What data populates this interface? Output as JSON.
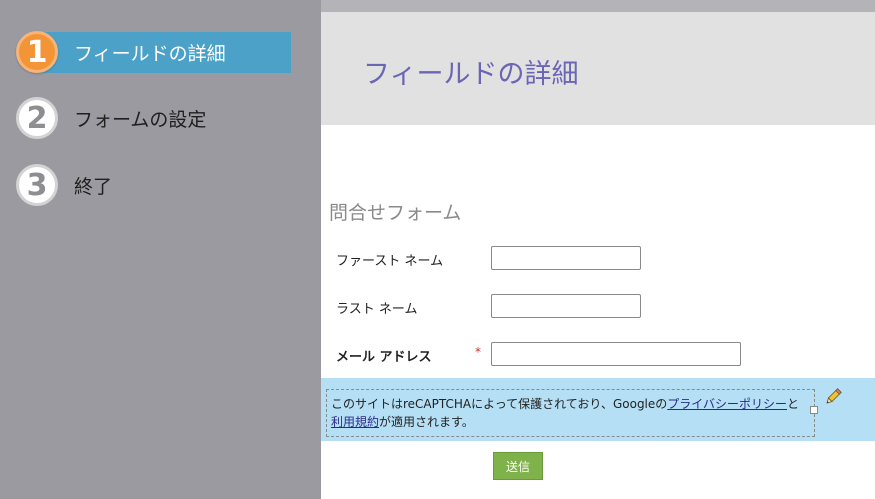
{
  "steps": [
    {
      "number": "1",
      "label": "フィールドの詳細",
      "active": true
    },
    {
      "number": "2",
      "label": "フォームの設定",
      "active": false
    },
    {
      "number": "3",
      "label": "終了",
      "active": false
    }
  ],
  "header": {
    "title": "フィールドの詳細"
  },
  "form": {
    "title": "問合せフォーム",
    "fields": [
      {
        "label": "ファースト ネーム",
        "value": "",
        "required": false
      },
      {
        "label": "ラスト ネーム",
        "value": "",
        "required": false
      },
      {
        "label": "メール アドレス",
        "value": "",
        "required": true
      }
    ],
    "required_mark": "*",
    "submit_label": "送信"
  },
  "captcha": {
    "text_1": "このサイトはreCAPTCHAによって保護されており、Googleの",
    "privacy_link": "プライバシーポリシー",
    "text_2": "と",
    "terms_link": "利用規約",
    "text_3": "が適用されます。"
  },
  "icons": {
    "edit": "pencil-icon",
    "resize": "resize-handle-icon"
  },
  "colors": {
    "sidebar_bg": "#9b9aa0",
    "active_step_bar": "#4ba1c7",
    "active_step_circle": "#f39536",
    "page_title": "#6b66b4",
    "captcha_band": "#b5dff5",
    "submit_button": "#7fb24a"
  }
}
